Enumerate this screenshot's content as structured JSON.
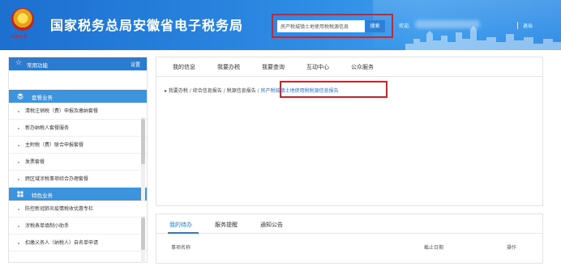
{
  "header": {
    "emblem_text": "中國稅務",
    "title": "国家税务总局安徽省电子税务局",
    "search": {
      "value": "房产税城镇土地使用税税源信息",
      "button": "搜索"
    },
    "welcome": "欢迎,",
    "logout": "退出",
    "accent_color": "#d0232a"
  },
  "sidebar": {
    "common_label": "常用功能",
    "settings_label": "设置",
    "packages_label": "套餐业务",
    "package_items": [
      "清税注销税（费）申报及缴纳套餐",
      "新办纳税人套餐服务",
      "主附税（费）联合申报套餐",
      "发票套餐",
      "跨区域涉税事项综合办理套餐"
    ],
    "special_label": "特色业务",
    "special_items": [
      "防控新冠肺炎疫情税收优惠专栏",
      "涉税表单填制小助手",
      "扣缴义务人（纳税人）自名单申请"
    ]
  },
  "main": {
    "nav": [
      "我的信息",
      "我要办税",
      "我要查询",
      "互动中心",
      "公众服务"
    ],
    "breadcrumb": {
      "items": [
        "我要办税",
        "综合信息报告",
        "税源信息报告"
      ],
      "current": "房产税城镇土地使用税税源信息报告"
    }
  },
  "bottom": {
    "tabs": [
      "我的待办",
      "服务提醒",
      "通知公告"
    ],
    "columns": [
      "事项名称",
      "截止日期",
      "操作"
    ]
  }
}
